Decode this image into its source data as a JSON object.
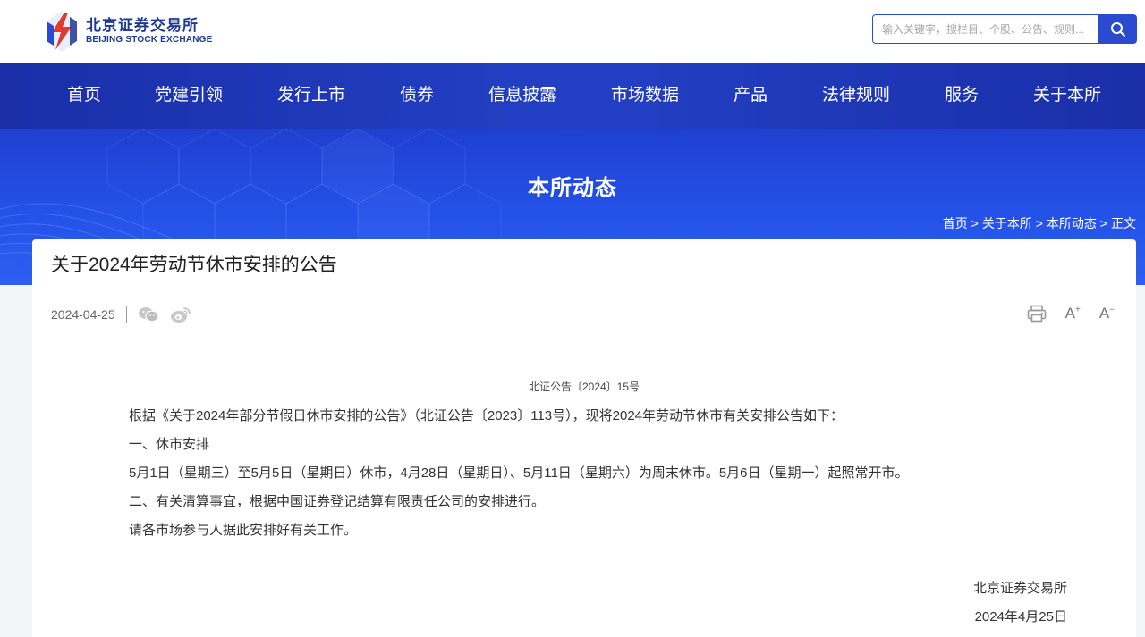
{
  "header": {
    "logo_cn": "北京证券交易所",
    "logo_en": "BEIJING STOCK EXCHANGE",
    "search_placeholder": "输入关键字，搜栏目、个股、公告、规则..."
  },
  "nav": {
    "items": [
      "首页",
      "党建引领",
      "发行上市",
      "债券",
      "信息披露",
      "市场数据",
      "产品",
      "法律规则",
      "服务",
      "关于本所"
    ]
  },
  "banner": {
    "title": "本所动态",
    "breadcrumb": [
      "首页 >",
      "关于本所 >",
      "本所动态 >",
      "正文"
    ]
  },
  "article": {
    "title": "关于2024年劳动节休市安排的公告",
    "date": "2024-04-25",
    "share_icons": [
      "wechat-icon",
      "weibo-icon"
    ],
    "tools": {
      "print": "print-icon",
      "font_larger": "A",
      "font_smaller": "A"
    },
    "doc_number": "北证公告〔2024〕15号",
    "paragraphs": [
      "根据《关于2024年部分节假日休市安排的公告》（北证公告〔2023〕113号），现将2024年劳动节休市有关安排公告如下：",
      "一、休市安排",
      "5月1日（星期三）至5月5日（星期日）休市，4月28日（星期日）、5月11日（星期六）为周末休市。5月6日（星期一）起照常开市。",
      "二、有关清算事宜，根据中国证券登记结算有限责任公司的安排进行。",
      "请各市场参与人据此安排好有关工作。"
    ],
    "signature": "北京证券交易所",
    "sign_date": "2024年4月25日"
  },
  "colors": {
    "brand_blue": "#2a4bd0",
    "nav_blue": "#1f37b8",
    "logo_red": "#e03a2f"
  }
}
